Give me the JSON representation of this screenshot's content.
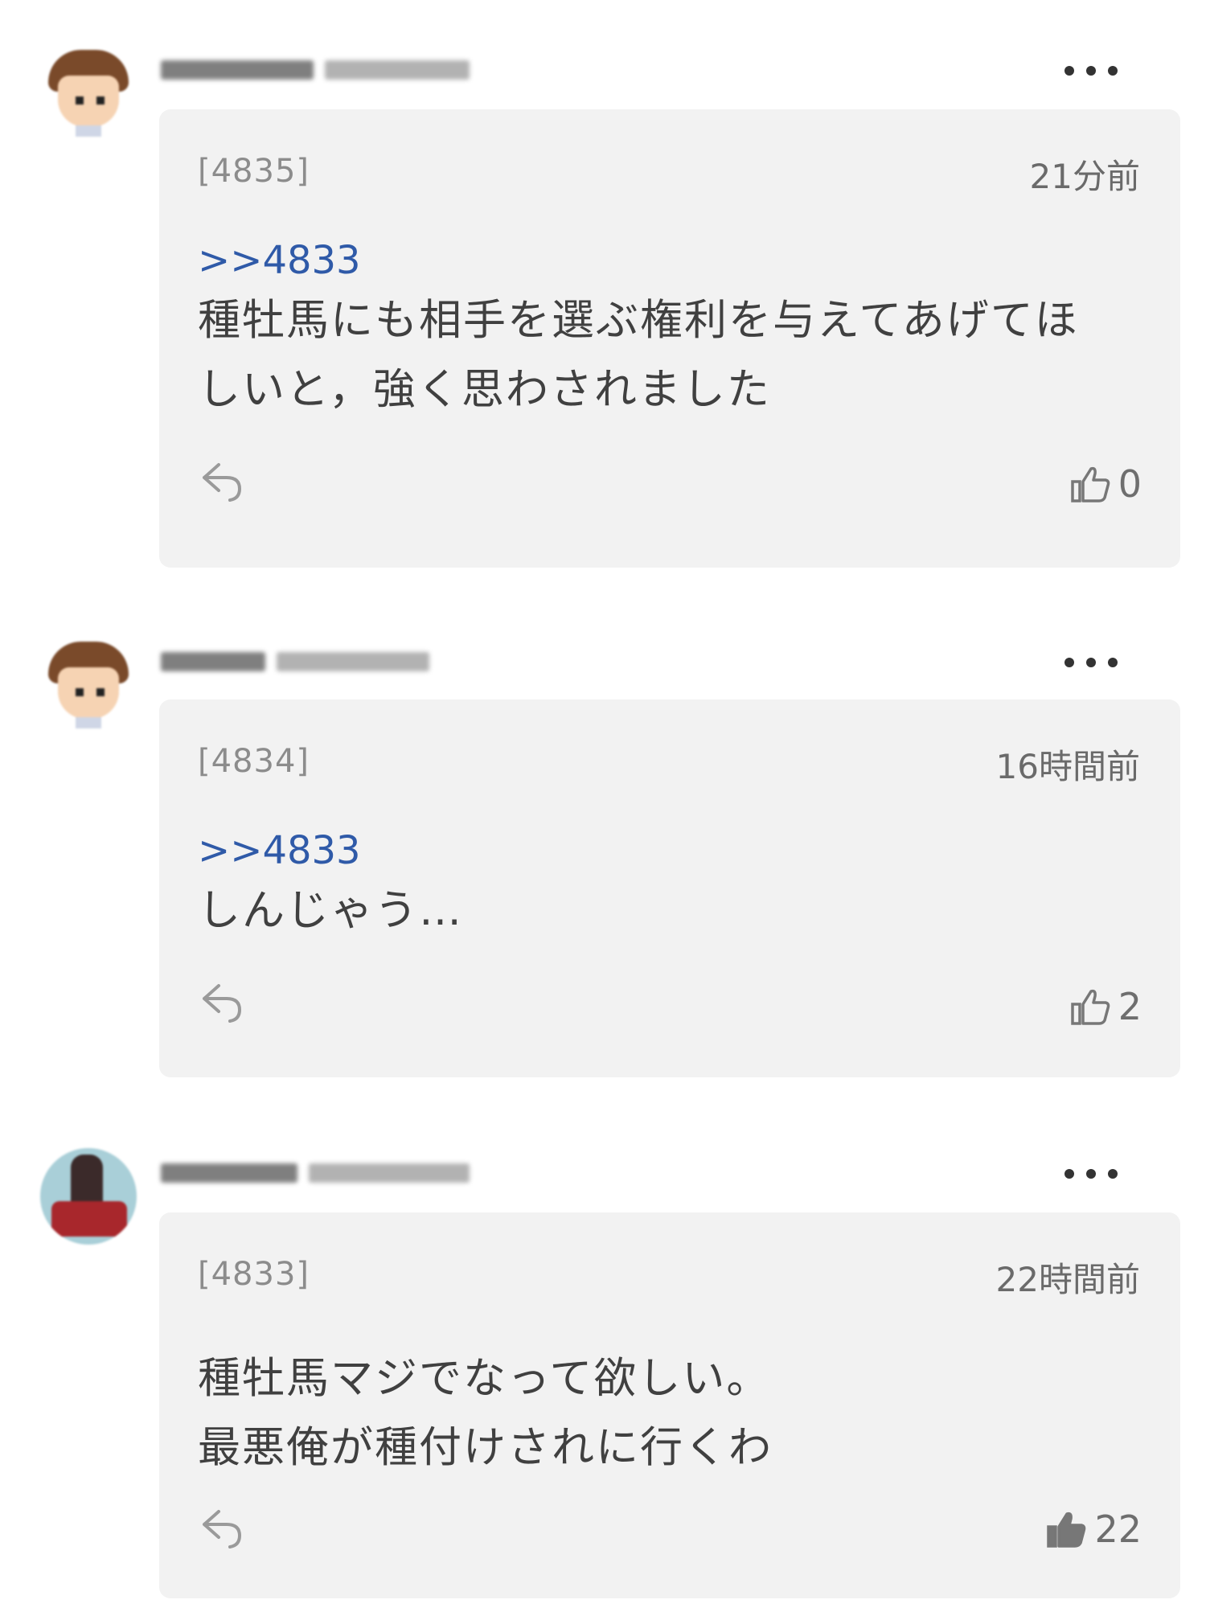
{
  "comments": [
    {
      "number": "[4835]",
      "time": "21分前",
      "reply_to": ">>4833",
      "lines": [
        "種牡馬にも相手を選ぶ権利を与えてあげてほ",
        "しいと，強く思わされました"
      ],
      "likes": "0",
      "liked": false,
      "avatar": "boy-avatar"
    },
    {
      "number": "[4834]",
      "time": "16時間前",
      "reply_to": ">>4833",
      "lines": [
        "しんじゃう…"
      ],
      "likes": "2",
      "liked": false,
      "avatar": "boy-avatar"
    },
    {
      "number": "[4833]",
      "time": "22時間前",
      "reply_to": "",
      "lines": [
        "種牡馬マジでなって欲しい。",
        "最悪俺が種付けされに行くわ"
      ],
      "likes": "22",
      "liked": true,
      "avatar": "character-avatar"
    }
  ],
  "icons": {
    "more": "more-dots-icon",
    "reply": "reply-arrow-icon",
    "like": "thumbs-up-icon"
  },
  "colors": {
    "card_bg": "#f2f2f2",
    "reply_link": "#2f5aa8",
    "text": "#404040",
    "muted": "#8c8c8c"
  }
}
